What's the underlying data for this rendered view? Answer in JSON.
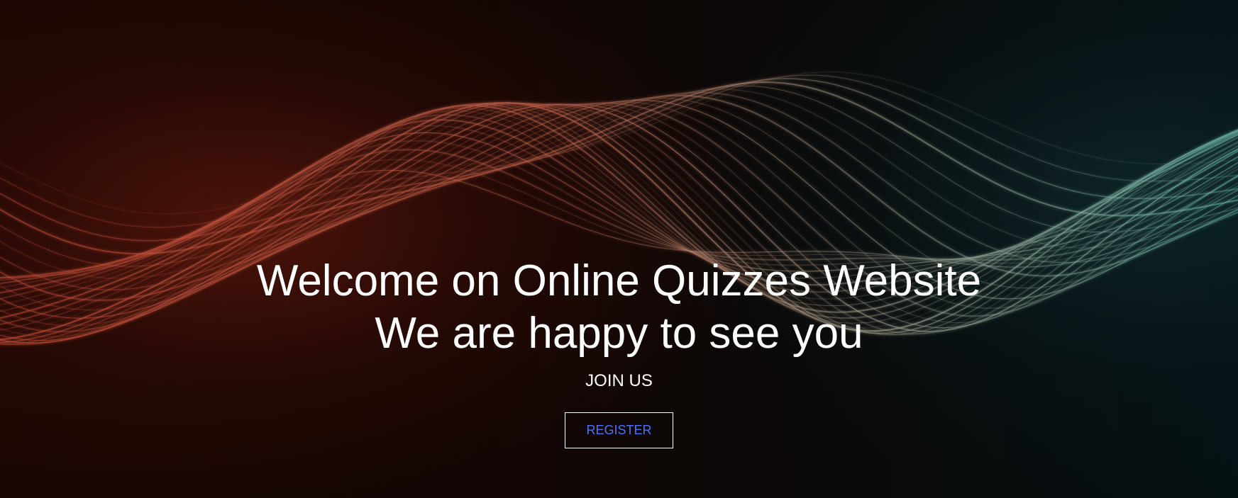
{
  "hero": {
    "title_line1": "Welcome on Online Quizzes Website",
    "title_line2": "We are happy to see you",
    "join_text": "JOIN US",
    "register_label": "REGISTER"
  },
  "colors": {
    "text": "#ffffff",
    "button_text": "#4a72ff",
    "button_border": "#ffffff",
    "wave_red": "#c8553f",
    "wave_teal": "#7fc4b0"
  }
}
